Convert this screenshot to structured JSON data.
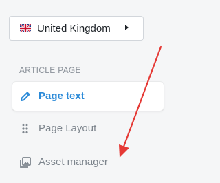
{
  "country_selector": {
    "label": "United Kingdom",
    "flag_icon": "uk-flag-icon",
    "caret_icon": "caret-right-icon"
  },
  "section": {
    "title": "ARTICLE PAGE"
  },
  "nav": {
    "items": [
      {
        "label": "Page text",
        "icon": "pencil-icon",
        "active": true
      },
      {
        "label": "Page Layout",
        "icon": "drag-handle-icon",
        "active": false
      },
      {
        "label": "Asset manager",
        "icon": "image-gallery-icon",
        "active": false
      }
    ]
  },
  "colors": {
    "background": "#f5f6f7",
    "accent": "#2b8ad8",
    "muted_text": "#7d858d",
    "section_title": "#8a9199",
    "annotation_arrow": "#e53935"
  }
}
